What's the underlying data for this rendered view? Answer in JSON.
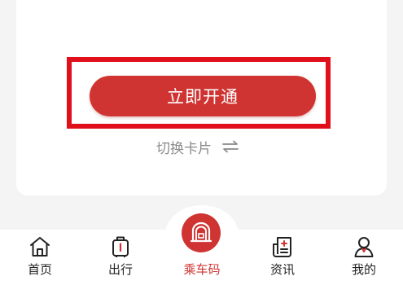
{
  "card": {
    "primary_button_label": "立即开通",
    "switch_card_label": "切换卡片"
  },
  "tabbar": {
    "tabs": [
      {
        "label": "首页",
        "icon": "home-icon"
      },
      {
        "label": "出行",
        "icon": "luggage-icon"
      },
      {
        "label": "乘车码",
        "icon": "subway-qr-icon",
        "active": true
      },
      {
        "label": "资讯",
        "icon": "news-icon"
      },
      {
        "label": "我的",
        "icon": "user-icon"
      }
    ]
  },
  "colors": {
    "accent": "#cf3432",
    "highlight": "#e0101a",
    "muted_text": "#8a8a8a"
  }
}
